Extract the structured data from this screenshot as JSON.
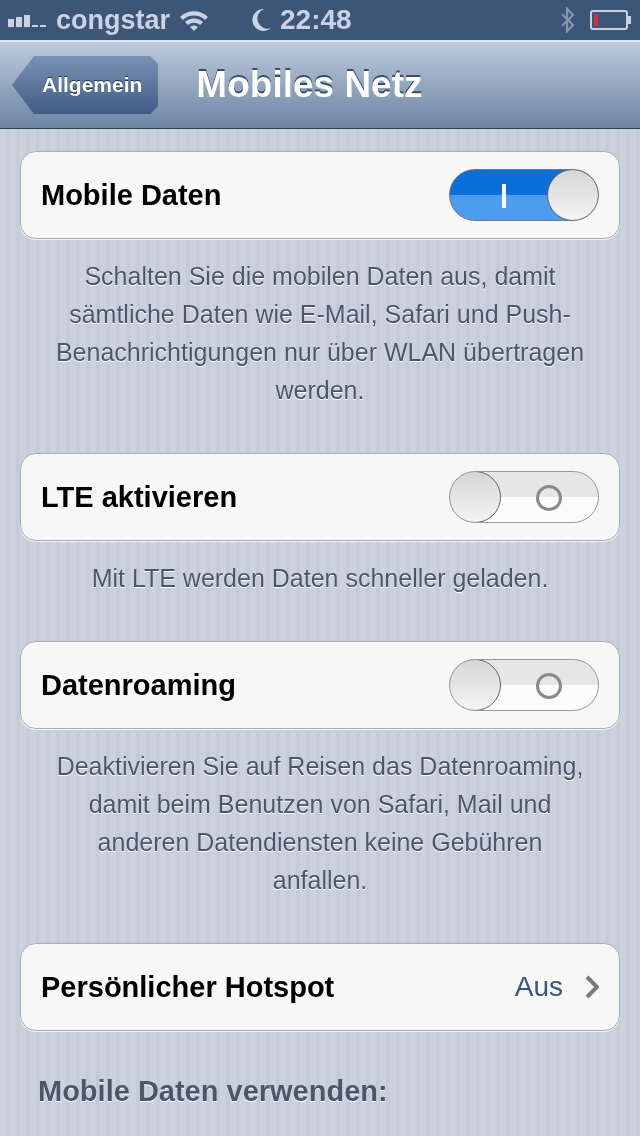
{
  "status_bar": {
    "carrier": "congstar",
    "time": "22:48"
  },
  "nav_bar": {
    "back": "Allgemein",
    "title": "Mobiles Netz"
  },
  "groups": [
    {
      "kind": "switch",
      "label": "Mobile Daten",
      "on": true,
      "footer": "Schalten Sie die mobilen Daten aus, damit sämtliche Daten wie E-Mail, Safari und Push-Benachrichtigungen nur über WLAN übertragen werden."
    },
    {
      "kind": "switch",
      "label": "LTE aktivieren",
      "on": false,
      "footer": "Mit LTE werden Daten schneller geladen."
    },
    {
      "kind": "switch",
      "label": "Datenroaming",
      "on": false,
      "footer": "Deaktivieren Sie auf Reisen das Datenroaming, damit beim Benutzen von Safari, Mail und anderen Datendiensten keine Gebühren anfallen."
    },
    {
      "kind": "link",
      "label": "Persönlicher Hotspot",
      "value": "Aus"
    }
  ],
  "section_header": "Mobile Daten verwenden:"
}
